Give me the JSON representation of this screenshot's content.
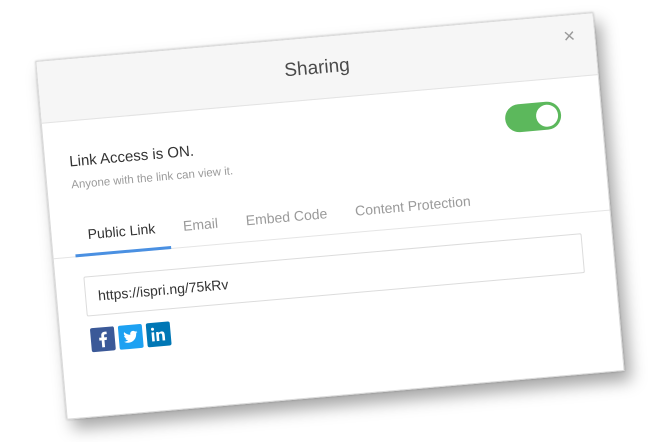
{
  "dialog": {
    "title": "Sharing",
    "close_label": "×"
  },
  "access": {
    "title": "Link Access is ON.",
    "description": "Anyone with the link can view it.",
    "toggle_on": true
  },
  "tabs": [
    {
      "label": "Public Link",
      "active": true
    },
    {
      "label": "Email",
      "active": false
    },
    {
      "label": "Embed Code",
      "active": false
    },
    {
      "label": "Content Protection",
      "active": false
    }
  ],
  "public_link": {
    "url": "https://ispri.ng/75kRv"
  },
  "social": [
    {
      "icon": "facebook-icon",
      "color": "#3b5998"
    },
    {
      "icon": "twitter-icon",
      "color": "#1da1f2"
    },
    {
      "icon": "linkedin-icon",
      "color": "#0077b5"
    }
  ],
  "colors": {
    "toggle_on": "#5cb85c",
    "active_tab_underline": "#4a90e2"
  }
}
